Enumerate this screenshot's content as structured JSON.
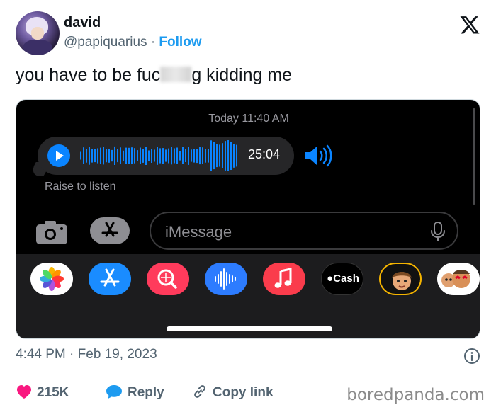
{
  "author": {
    "name": "david",
    "handle": "@papiquarius",
    "separator": "·",
    "follow_label": "Follow"
  },
  "tweet": {
    "text_before": "you have to be fuc",
    "text_after": "g kidding me"
  },
  "screenshot": {
    "timestamp": "Today 11:40 AM",
    "audio_duration": "25:04",
    "raise_to_listen": "Raise to listen",
    "imessage_placeholder": "iMessage",
    "apps": [
      "photos",
      "app-store",
      "search-images",
      "audio-message",
      "music",
      "apple-cash",
      "memoji",
      "memoji-stickers"
    ],
    "cash_label": "Cash",
    "accent": "#0a84ff"
  },
  "meta": {
    "time": "4:44 PM",
    "separator": "·",
    "date": "Feb 19, 2023"
  },
  "actions": {
    "likes": "215K",
    "reply": "Reply",
    "copy_link": "Copy link"
  },
  "watermark": "boredpanda.com",
  "colors": {
    "like": "#f91880",
    "link": "#1d9bf0",
    "muted": "#536471"
  }
}
